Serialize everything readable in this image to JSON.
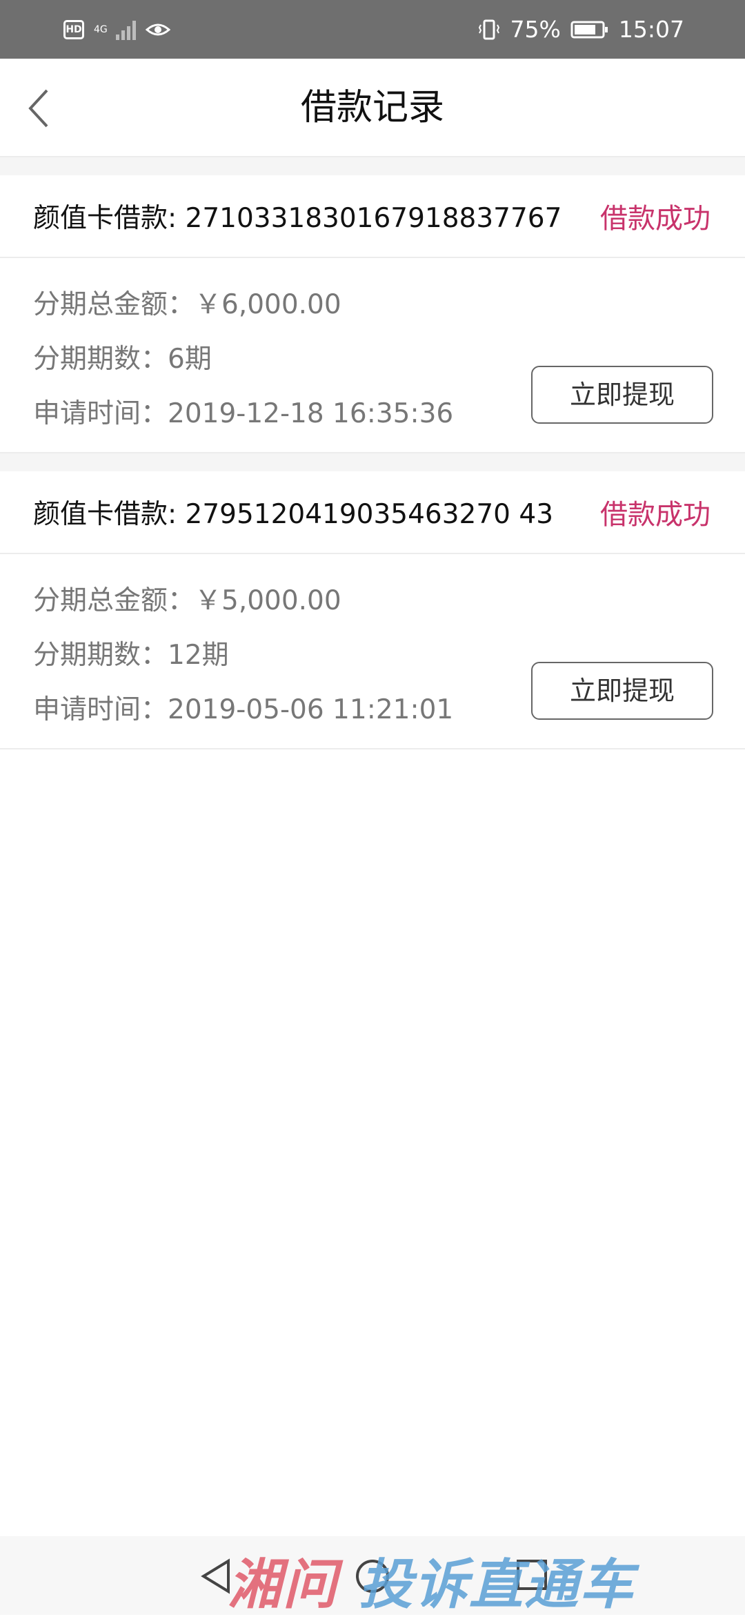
{
  "status_bar": {
    "hd_label": "HD",
    "network_label": "4G",
    "battery_percent": "75%",
    "time": "15:07"
  },
  "header": {
    "title": "借款记录"
  },
  "records": [
    {
      "card_label": "颜值卡借款:",
      "order_no": "2710331830167918837767",
      "status": "借款成功",
      "amount_label": "分期总金额：",
      "amount_value": "￥6,000.00",
      "periods_label": "分期期数：",
      "periods_value": "6期",
      "time_label": "申请时间：",
      "time_value": "2019-12-18 16:35:36",
      "button_label": "立即提现"
    },
    {
      "card_label": "颜值卡借款:",
      "order_no": "2795120419035463270 43",
      "status": "借款成功",
      "amount_label": "分期总金额：",
      "amount_value": "￥5,000.00",
      "periods_label": "分期期数：",
      "periods_value": "12期",
      "time_label": "申请时间：",
      "time_value": "2019-05-06 11:21:01",
      "button_label": "立即提现"
    }
  ],
  "watermark": {
    "part1": "湘问",
    "part2": "投诉直通车"
  },
  "colors": {
    "status_success": "#c8336b",
    "status_bar_bg": "#6f6f6f"
  }
}
